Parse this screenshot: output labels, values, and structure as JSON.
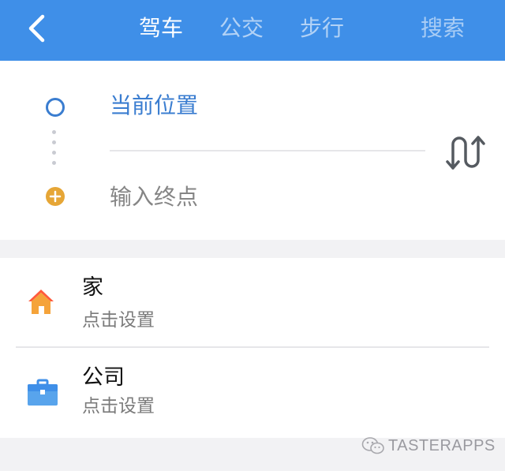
{
  "header": {
    "tabs": [
      {
        "label": "驾车",
        "active": true
      },
      {
        "label": "公交",
        "active": false
      },
      {
        "label": "步行",
        "active": false
      }
    ],
    "search_label": "搜索",
    "background_color": "#3f8fe8"
  },
  "route": {
    "origin": "当前位置",
    "destination_placeholder": "输入终点",
    "origin_color": "#3a7dd0",
    "destination_marker_color": "#e6a636"
  },
  "places": [
    {
      "title": "家",
      "subtitle": "点击设置",
      "icon": "home-icon"
    },
    {
      "title": "公司",
      "subtitle": "点击设置",
      "icon": "briefcase-icon"
    }
  ],
  "watermark": {
    "text": "TASTERAPPS",
    "icon": "wechat-icon"
  }
}
